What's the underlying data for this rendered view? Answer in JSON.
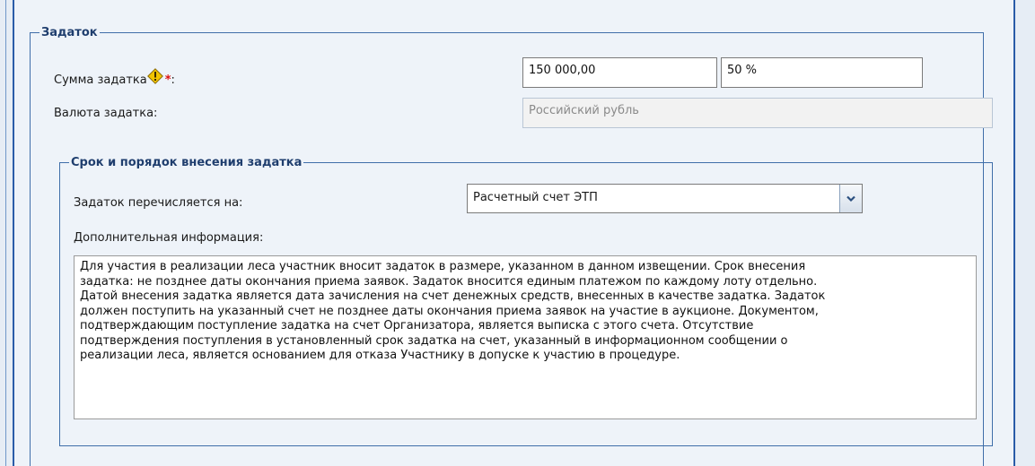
{
  "deposit": {
    "legend": "Задаток",
    "amount_label": "Сумма задатка",
    "required_mark": "*",
    "label_colon": ":",
    "amount_value": "150 000,00",
    "percent_value": "50 %",
    "currency_label": "Валюта задатка:",
    "currency_value": "Российский рубль",
    "hint_icon": "warning-hint-icon"
  },
  "payment_terms": {
    "legend": "Срок и порядок внесения задатка",
    "transfer_label": "Задаток перечисляется на:",
    "transfer_selected": "Расчетный счет ЭТП",
    "dropdown_icon": "chevron-down-icon",
    "additional_label": "Дополнительная информация:",
    "additional_text": "Для участия в реализации леса участник вносит задаток в размере, указанном в данном извещении. Срок внесения\nзадатка: не позднее даты окончания приема заявок. Задаток вносится единым платежом по каждому лоту отдельно.\nДатой внесения задатка является дата зачисления на счет денежных средств, внесенных в качестве задатка. Задаток\nдолжен поступить на указанный счет не позднее даты окончания приема заявок на участие в аукционе. Документом,\nподтверждающим поступление задатка на счет Организатора, является выписка с этого счета. Отсутствие\nподтверждения поступления в установленный срок задатка на счет, указанный в информационном сообщении о\nреализации леса, является основанием для отказа Участнику в допуске к участию в процедуре."
  },
  "colors": {
    "accent": "#2a5ca8",
    "legend_text": "#1f3e6e",
    "required": "#dd1111",
    "hint_icon": "#f2c400"
  }
}
